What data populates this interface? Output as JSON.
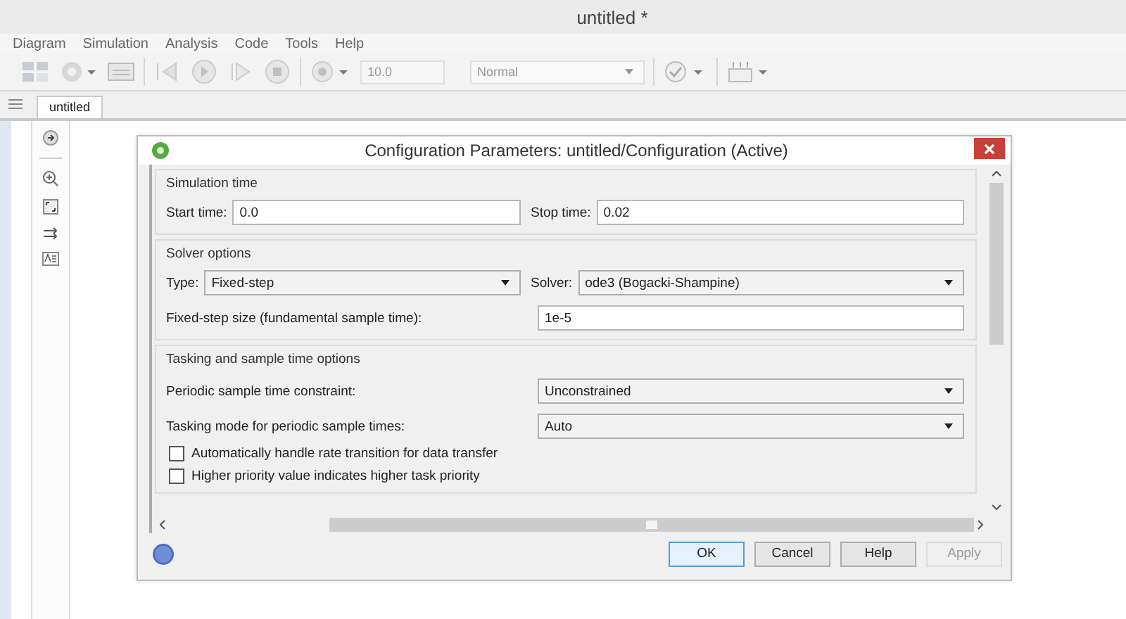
{
  "window": {
    "title": "untitled *"
  },
  "menu": [
    "Diagram",
    "Simulation",
    "Analysis",
    "Code",
    "Tools",
    "Help"
  ],
  "toolbar": {
    "stop_time": "10.0",
    "mode": "Normal"
  },
  "tabs": [
    {
      "label": "untitled",
      "selected": true
    }
  ],
  "dialog": {
    "title": "Configuration Parameters: untitled/Configuration (Active)",
    "sections": [
      {
        "title": "Simulation time",
        "rows": [
          {
            "kind": "pair",
            "fields": [
              {
                "label": "Start time:",
                "kind": "text",
                "value": "0.0"
              },
              {
                "label": "Stop time:",
                "kind": "text",
                "value": "0.02"
              }
            ]
          }
        ]
      },
      {
        "title": "Solver options",
        "rows": [
          {
            "kind": "pair",
            "fields": [
              {
                "label": "Type:",
                "kind": "select",
                "value": "Fixed-step"
              },
              {
                "label": "Solver:",
                "kind": "select",
                "value": "ode3 (Bogacki-Shampine)"
              }
            ]
          },
          {
            "kind": "labeled",
            "label": "Fixed-step size (fundamental sample time):",
            "field": {
              "kind": "text",
              "value": "1e-5"
            }
          }
        ]
      },
      {
        "title": "Tasking and sample time options",
        "rows": [
          {
            "kind": "labeled",
            "label": "Periodic sample time constraint:",
            "field": {
              "kind": "select",
              "value": "Unconstrained"
            }
          },
          {
            "kind": "labeled",
            "label": "Tasking mode for periodic sample times:",
            "field": {
              "kind": "select",
              "value": "Auto"
            }
          },
          {
            "kind": "checkbox",
            "label": "Automatically handle rate transition for data transfer",
            "checked": false
          },
          {
            "kind": "checkbox",
            "label": "Higher priority value indicates higher task priority",
            "checked": false
          }
        ]
      }
    ],
    "buttons": [
      {
        "label": "OK",
        "default": true,
        "disabled": false
      },
      {
        "label": "Cancel",
        "default": false,
        "disabled": false
      },
      {
        "label": "Help",
        "default": false,
        "disabled": false
      },
      {
        "label": "Apply",
        "default": false,
        "disabled": true
      }
    ]
  }
}
